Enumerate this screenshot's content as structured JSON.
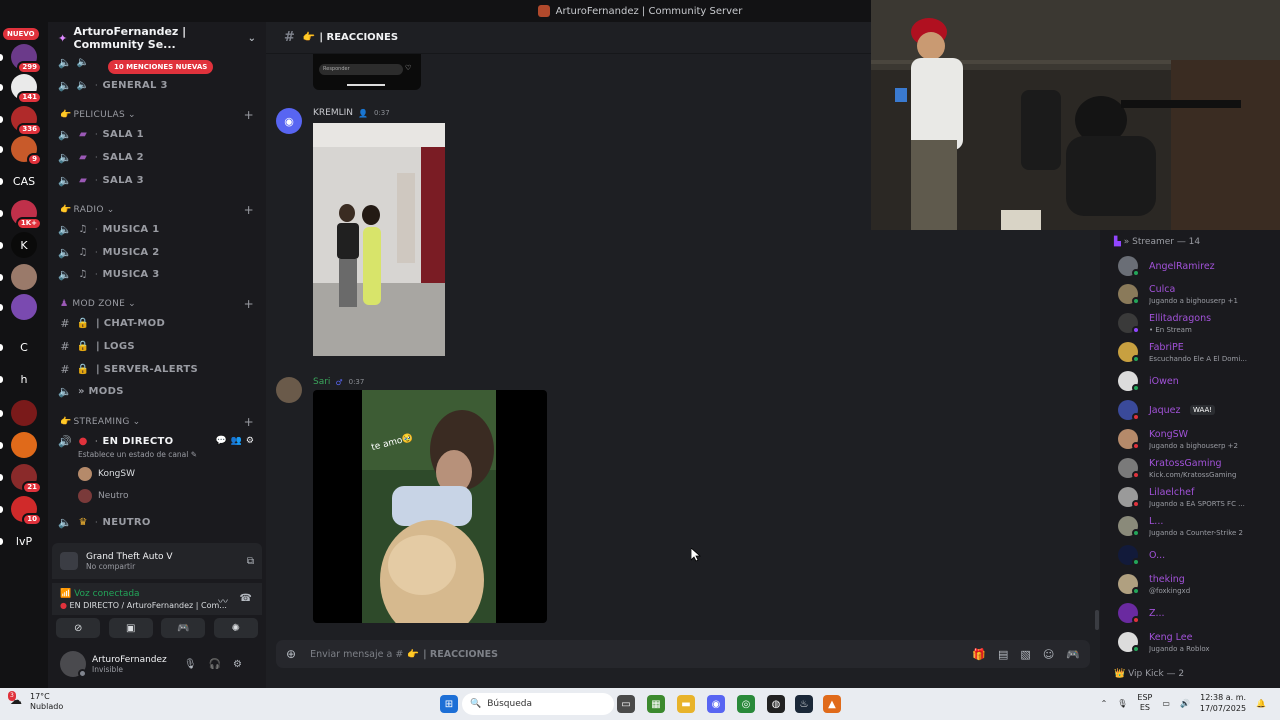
{
  "window": {
    "title": "ArturoFernandez | Community Server"
  },
  "rail": {
    "nuevo": "NUEVO",
    "servers": [
      {
        "badge": "299",
        "color": "#6b3a8a",
        "text": ""
      },
      {
        "badge": "141",
        "color": "#eaeaea",
        "text": ""
      },
      {
        "badge": "336",
        "color": "#b02a2a",
        "text": ""
      },
      {
        "badge": "9",
        "color": "#c85a2a",
        "text": ""
      },
      {
        "badge": "",
        "color": "#121214",
        "text": "CAS"
      },
      {
        "badge": "1K+",
        "color": "#c0304a",
        "text": ""
      },
      {
        "badge": "",
        "color": "#0a0a0a",
        "text": "K"
      },
      {
        "badge": "",
        "color": "#9a7a6a",
        "text": ""
      },
      {
        "badge": "",
        "color": "#7a4ab0",
        "text": ""
      },
      {
        "badge": "",
        "color": "#121214",
        "text": "C"
      },
      {
        "badge": "",
        "color": "#121214",
        "text": "h"
      },
      {
        "badge": "",
        "color": "#7a1a1a",
        "text": ""
      },
      {
        "badge": "",
        "color": "#e06a1a",
        "text": ""
      },
      {
        "badge": "21",
        "color": "#8a2a2a",
        "text": ""
      },
      {
        "badge": "10",
        "color": "#d02a2a",
        "text": ""
      },
      {
        "badge": "",
        "color": "#121214",
        "text": "lvP"
      }
    ]
  },
  "sidebar": {
    "server_name": "ArturoFernandez | Community Se...",
    "mention_pill": "10 MENCIONES NUEVAS",
    "channels": {
      "general3": "GENERAL 3",
      "peliculas_cat": "PELICULAS",
      "sala1": "SALA 1",
      "sala2": "SALA 2",
      "sala3": "SALA 3",
      "radio_cat": "RADIO",
      "musica1": "MUSICA 1",
      "musica2": "MUSICA 2",
      "musica3": "MUSICA 3",
      "modzone_cat": "MOD ZONE",
      "chatmod": "| CHAT-MOD",
      "logs": "| LOGS",
      "serveralerts": "| SERVER-ALERTS",
      "mods": "» MODS",
      "streaming_cat": "STREAMING",
      "endirecto": "EN DIRECTO",
      "endirecto_status": "Establece un estado de canal",
      "voice_user1": "KongSW",
      "voice_user2": "Neutro",
      "neutro": "NEUTRO"
    }
  },
  "activity": {
    "game": "Grand Theft Auto V",
    "share": "No compartir"
  },
  "voice": {
    "status": "Voz conectada",
    "channel": "EN DIRECTO / ArturoFernandez | Com..."
  },
  "user": {
    "name": "ArturoFernandez",
    "status": "Invisible"
  },
  "chat": {
    "channel": "| REACCIONES",
    "reply_label": "Responder",
    "messages": [
      {
        "author": "KREMLIN",
        "time": "0:37",
        "color": "#c9cacf"
      },
      {
        "author": "Sari",
        "time": "0:37",
        "color": "#3ba55c"
      }
    ],
    "video_caption": "te amo🥹",
    "composer_placeholder": "Enviar mensaje a #",
    "composer_channel": "| REACCIONES"
  },
  "members": {
    "section1": "» Streamer — 14",
    "section2": "Vip Kick — 2",
    "list": [
      {
        "name": "AngelRamirez",
        "activity": "",
        "status": "#23a559",
        "av": "#6a6e76"
      },
      {
        "name": "Culca",
        "activity": "Jugando a bighouserp +1",
        "status": "#23a559",
        "av": "#8a7a5a"
      },
      {
        "name": "Ellitadragons",
        "activity": "• En Stream",
        "status": "#9146ff",
        "av": "#3a3a3a"
      },
      {
        "name": "FabriPE",
        "activity": "Escuchando Ele A El Domi...",
        "status": "#23a559",
        "av": "#c8a040"
      },
      {
        "name": "iOwen",
        "activity": "",
        "status": "#23a559",
        "av": "#dcdcdc"
      },
      {
        "name": "Jaquez",
        "activity": "",
        "status": "#e0323c",
        "av": "#3a4a9a"
      },
      {
        "name": "KongSW",
        "activity": "Jugando a bighouserp +2",
        "status": "#e0323c",
        "av": "#b58a6a"
      },
      {
        "name": "KratossGaming",
        "activity": "Kick.com/KratossGaming",
        "status": "#e0323c",
        "av": "#7a7a7a"
      },
      {
        "name": "Lilaelchef",
        "activity": "Jugando a EA SPORTS FC ...",
        "status": "#e0323c",
        "av": "#9a9a9a"
      },
      {
        "name": "L...",
        "activity": "Jugando a Counter-Strike 2",
        "status": "#23a559",
        "av": "#8a8a7a"
      },
      {
        "name": "O...",
        "activity": "",
        "status": "#23a559",
        "av": "#121a3a"
      },
      {
        "name": "theking",
        "activity": "@foxkingxd",
        "status": "#23a559",
        "av": "#b0a080"
      },
      {
        "name": "Z...",
        "activity": "",
        "status": "#e0323c",
        "av": "#6a2aa0"
      },
      {
        "name": "Keng Lee",
        "activity": "Jugando a Roblox",
        "status": "#23a559",
        "av": "#dcdcdc"
      }
    ],
    "jaquez_tag": "WAA!"
  },
  "taskbar": {
    "weather_badge": "3",
    "temp": "17°C",
    "condition": "Nublado",
    "search": "Búsqueda",
    "lang1": "ESP",
    "lang2": "ES",
    "time": "12:38 a. m.",
    "date": "17/07/2025"
  },
  "colors": {
    "accent": "#5865f2",
    "live": "#e0323c",
    "online": "#23a559"
  }
}
